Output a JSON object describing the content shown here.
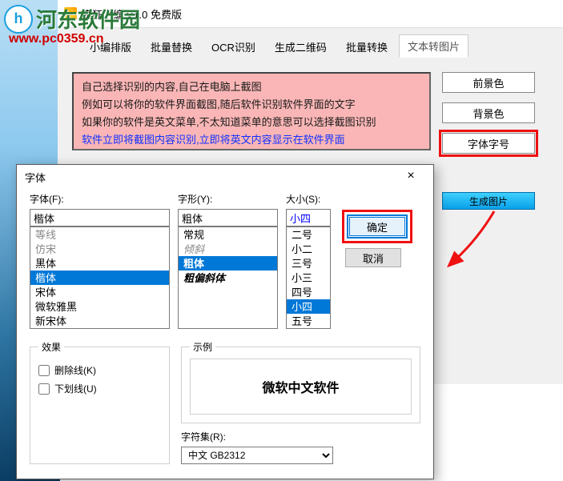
{
  "watermark": {
    "site": "河东软件园",
    "url": "www.pc0359.cn"
  },
  "main": {
    "title": "疯狂小编 V1.0 免费版",
    "tabs": [
      "小编排版",
      "批量替换",
      "OCR识别",
      "生成二维码",
      "批量转换",
      "文本转图片"
    ],
    "active_tab_index": 5,
    "preview": {
      "l1": "自己选择识别的内容,自己在电脑上截图",
      "l2": "例如可以将你的软件界面截图,随后软件识别软件界面的文字",
      "l3": "如果你的软件是英文菜单,不太知道菜单的意思可以选择截图识别",
      "l4": "软件立即将截图内容识别,立即将英文内容显示在软件界面"
    },
    "side": {
      "fg": "前景色",
      "bg": "背景色",
      "font": "字体字号",
      "gen": "生成图片"
    }
  },
  "dlg": {
    "title": "字体",
    "font_label": "字体(F):",
    "font_value": "楷体",
    "font_list": [
      "等线",
      "仿宋",
      "黑体",
      "楷体",
      "宋体",
      "微软雅黑",
      "新宋体"
    ],
    "font_sel_index": 3,
    "style_label": "字形(Y):",
    "style_value": "粗体",
    "style_list": [
      "常规",
      "倾斜",
      "粗体",
      "粗偏斜体"
    ],
    "style_sel_index": 2,
    "size_label": "大小(S):",
    "size_value": "小四",
    "size_list": [
      "二号",
      "小二",
      "三号",
      "小三",
      "四号",
      "小四",
      "五号"
    ],
    "size_sel_index": 5,
    "ok": "确定",
    "cancel": "取消",
    "effects_label": "效果",
    "strike": "删除线(K)",
    "underline": "下划线(U)",
    "sample_label": "示例",
    "sample_text": "微软中文软件",
    "charset_label": "字符集(R):",
    "charset_value": "中文 GB2312"
  }
}
